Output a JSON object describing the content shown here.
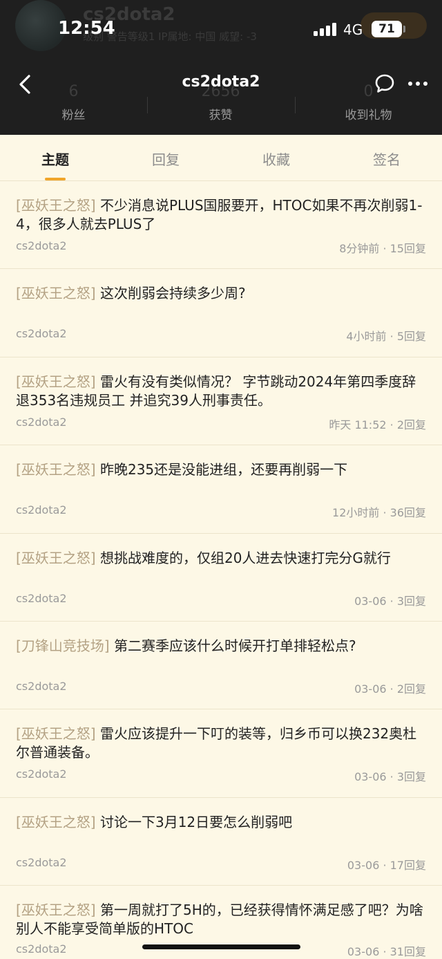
{
  "status_bar": {
    "time": "12:54",
    "network": "4G",
    "battery": "71"
  },
  "profile_ghost": {
    "name": "cs2dota2",
    "meta": "级别 警告等级1 IP属地: 中国 威望: -3"
  },
  "nav": {
    "title": "cs2dota2"
  },
  "stats": [
    {
      "num": "6",
      "label": "粉丝"
    },
    {
      "num": "2656",
      "label": "获赞"
    },
    {
      "num": "0",
      "label": "收到礼物"
    }
  ],
  "tabs": [
    {
      "label": "主题",
      "active": true
    },
    {
      "label": "回复",
      "active": false
    },
    {
      "label": "收藏",
      "active": false
    },
    {
      "label": "签名",
      "active": false
    }
  ],
  "colors": {
    "header_bg": "#1f1f1f",
    "page_bg": "#fdf8e6",
    "accent": "#f0a52a",
    "forum_tag": "#b4a284"
  },
  "threads": [
    {
      "forum": "[巫妖王之怒]",
      "title": "不少消息说PLUS国服要开，HTOC如果不再次削弱1-4，很多人就去PLUS了",
      "author": "cs2dota2",
      "meta": "8分钟前 · 15回复"
    },
    {
      "forum": "[巫妖王之怒]",
      "title": "这次削弱会持续多少周?",
      "author": "cs2dota2",
      "meta": "4小时前 · 5回复"
    },
    {
      "forum": "[巫妖王之怒]",
      "title": "雷火有没有类似情况？ 字节跳动2024年第四季度辞退353名违规员工 并追究39人刑事责任。",
      "author": "cs2dota2",
      "meta": "昨天 11:52 · 2回复"
    },
    {
      "forum": "[巫妖王之怒]",
      "title": "昨晚235还是没能进组，还要再削弱一下",
      "author": "cs2dota2",
      "meta": "12小时前 · 36回复"
    },
    {
      "forum": "[巫妖王之怒]",
      "title": "想挑战难度的，仅组20人进去快速打完分G就行",
      "author": "cs2dota2",
      "meta": "03-06 · 3回复"
    },
    {
      "forum": "[刀锋山竞技场]",
      "title": "第二赛季应该什么时候开打单排轻松点?",
      "author": "cs2dota2",
      "meta": "03-06 · 2回复"
    },
    {
      "forum": "[巫妖王之怒]",
      "title": "雷火应该提升一下叮的装等，归乡币可以换232奥杜尔普通装备。",
      "author": "cs2dota2",
      "meta": "03-06 · 3回复"
    },
    {
      "forum": "[巫妖王之怒]",
      "title": "讨论一下3月12日要怎么削弱吧",
      "author": "cs2dota2",
      "meta": "03-06 · 17回复"
    },
    {
      "forum": "[巫妖王之怒]",
      "title": "第一周就打了5H的，已经获得情怀满足感了吧？为啥别人不能享受简单版的HTOC",
      "author": "cs2dota2",
      "meta": "03-06 · 31回复"
    }
  ]
}
